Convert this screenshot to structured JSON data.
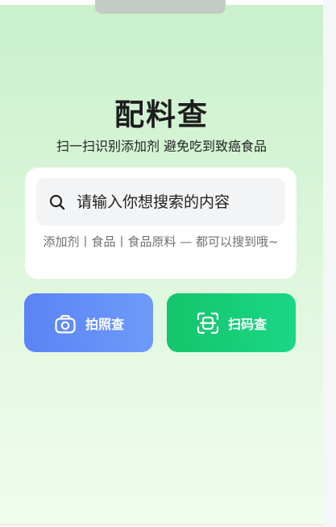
{
  "app": {
    "title": "配料查",
    "subtitle": "扫一扫识别添加剂 避免吃到致癌食品"
  },
  "search": {
    "placeholder": "请输入你想搜索的内容",
    "hint": "添加剂丨食品丨食品原料 — 都可以搜到哦~"
  },
  "actions": {
    "photo_label": "拍照查",
    "scan_label": "扫码查"
  },
  "icons": {
    "search": "search-icon",
    "photo": "camera-icon",
    "scan": "scan-icon"
  },
  "colors": {
    "photo_button": "#5b83f5",
    "scan_button": "#13c56b",
    "title": "#1e1e1e"
  }
}
